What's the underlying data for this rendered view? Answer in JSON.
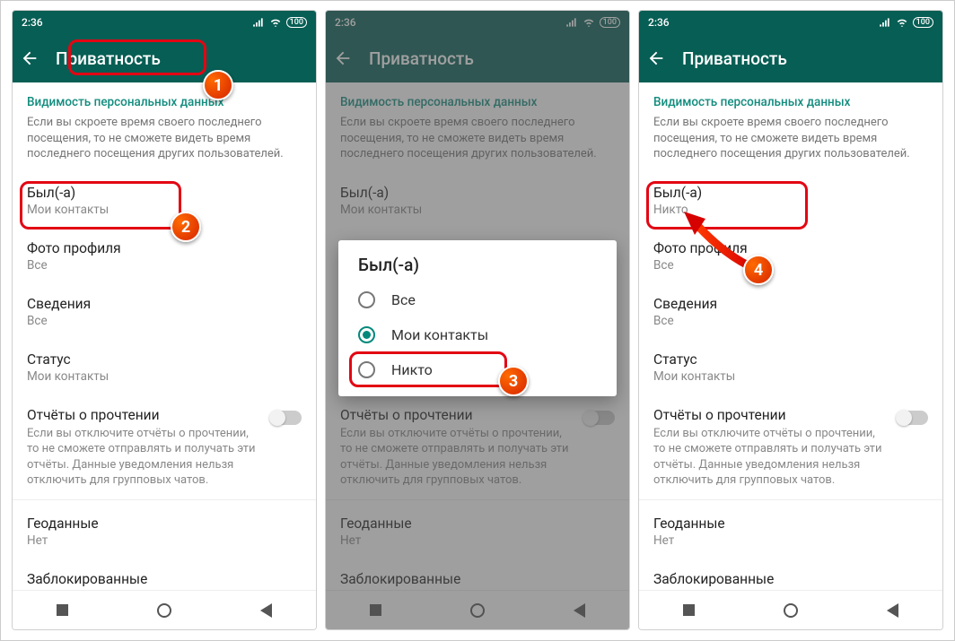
{
  "status": {
    "time": "2:36",
    "battery": "100"
  },
  "appbar": {
    "title": "Приватность"
  },
  "section": {
    "title": "Видимость персональных данных",
    "desc": "Если вы скроете время своего последнего посещения, то не сможете видеть время последнего посещения других пользователей."
  },
  "items": {
    "lastseen_label": "Был(-а)",
    "lastseen_val_s1": "Мои контакты",
    "lastseen_val_s3": "Никто",
    "photo_label": "Фото профиля",
    "photo_val": "Все",
    "about_label": "Сведения",
    "about_val": "Все",
    "status_label": "Статус",
    "status_val": "Мои контакты",
    "read_label": "Отчёты о прочтении",
    "read_desc": "Если вы отключите отчёты о прочтении, то не сможете отправлять и получать эти отчёты. Данные уведомления нельзя отключить для групповых чатов.",
    "geo_label": "Геоданные",
    "geo_val": "Нет",
    "blocked_label": "Заблокированные"
  },
  "dialog": {
    "title": "Был(-а)",
    "opt_all": "Все",
    "opt_contacts": "Мои контакты",
    "opt_nobody": "Никто"
  },
  "badges": {
    "b1": "1",
    "b2": "2",
    "b3": "3",
    "b4": "4"
  }
}
